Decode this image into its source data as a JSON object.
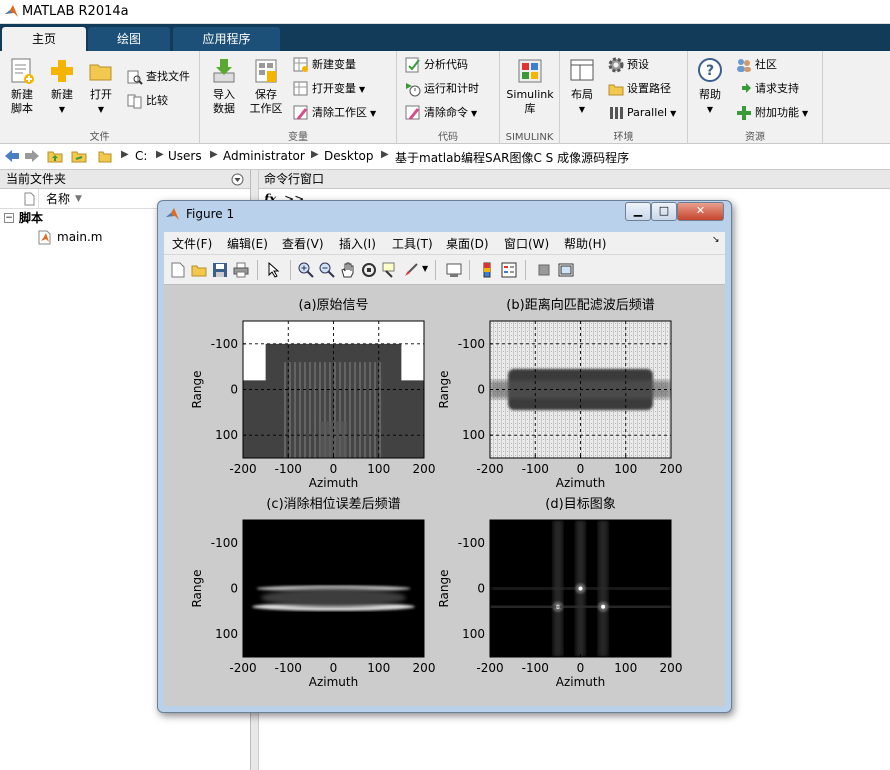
{
  "app": {
    "title": "MATLAB R2014a"
  },
  "ribbon": {
    "tabs": [
      "主页",
      "绘图",
      "应用程序"
    ],
    "groups": {
      "file": {
        "label": "文件",
        "new_script": [
          "新建",
          "脚本"
        ],
        "new": "新建",
        "open": "打开",
        "find_files": "查找文件",
        "compare": "比较"
      },
      "variable": {
        "label": "变量",
        "import": [
          "导入",
          "数据"
        ],
        "save": [
          "保存",
          "工作区"
        ],
        "new_var": "新建变量",
        "open_var": "打开变量",
        "clear_ws": "清除工作区"
      },
      "code": {
        "label": "代码",
        "analyze": "分析代码",
        "run_time": "运行和计时",
        "clear_cmds": "清除命令"
      },
      "simulink": {
        "label": "SIMULINK",
        "lib": [
          "Simulink",
          "库"
        ]
      },
      "env": {
        "label": "环境",
        "layout": "布局",
        "prefs": "预设",
        "set_path": "设置路径",
        "parallel": "Parallel"
      },
      "resources": {
        "label": "资源",
        "help": "帮助",
        "community": "社区",
        "support": "请求支持",
        "addons": "附加功能"
      }
    }
  },
  "address": {
    "parts": [
      "C:",
      "Users",
      "Administrator",
      "Desktop",
      "基于matlab编程SAR图像C S 成像源码程序"
    ]
  },
  "current_folder": {
    "title": "当前文件夹",
    "column": "名称",
    "group": "脚本",
    "files": [
      "main.m"
    ]
  },
  "command_window": {
    "title": "命令行窗口",
    "prompt": ">>"
  },
  "figure": {
    "title": "Figure 1",
    "menu": [
      "文件(F)",
      "编辑(E)",
      "查看(V)",
      "插入(I)",
      "工具(T)",
      "桌面(D)",
      "窗口(W)",
      "帮助(H)"
    ]
  },
  "chart_data": [
    {
      "type": "heatmap",
      "title": "(a)原始信号",
      "xlabel": "Azimuth",
      "ylabel": "Range",
      "xlim": [
        -200,
        200
      ],
      "ylim": [
        150,
        -150
      ],
      "xticks": [
        -200,
        -100,
        0,
        100,
        200
      ],
      "yticks": [
        -100,
        0,
        100
      ],
      "colormap": "gray",
      "grid": true
    },
    {
      "type": "heatmap",
      "title": "(b)距离向匹配滤波后频谱",
      "xlabel": "Azimuth",
      "ylabel": "Range",
      "xlim": [
        -200,
        200
      ],
      "ylim": [
        150,
        -150
      ],
      "xticks": [
        -200,
        -100,
        0,
        100,
        200
      ],
      "yticks": [
        -100,
        0,
        100
      ],
      "colormap": "gray",
      "grid": true
    },
    {
      "type": "heatmap",
      "title": "(c)消除相位误差后频谱",
      "xlabel": "Azimuth",
      "ylabel": "Range",
      "xlim": [
        -200,
        200
      ],
      "ylim": [
        150,
        -150
      ],
      "xticks": [
        -200,
        -100,
        0,
        100,
        200
      ],
      "yticks": [
        -100,
        0,
        100
      ],
      "colormap": "gray",
      "grid": false
    },
    {
      "type": "heatmap",
      "title": "(d)目标图象",
      "xlabel": "Azimuth",
      "ylabel": "Range",
      "xlim": [
        -200,
        200
      ],
      "ylim": [
        150,
        -150
      ],
      "xticks": [
        -200,
        -100,
        0,
        100,
        200
      ],
      "yticks": [
        -100,
        0,
        100
      ],
      "colormap": "gray",
      "grid": false,
      "targets": [
        {
          "x": -50,
          "y": 40
        },
        {
          "x": 0,
          "y": 0
        },
        {
          "x": 50,
          "y": 40
        }
      ]
    }
  ]
}
